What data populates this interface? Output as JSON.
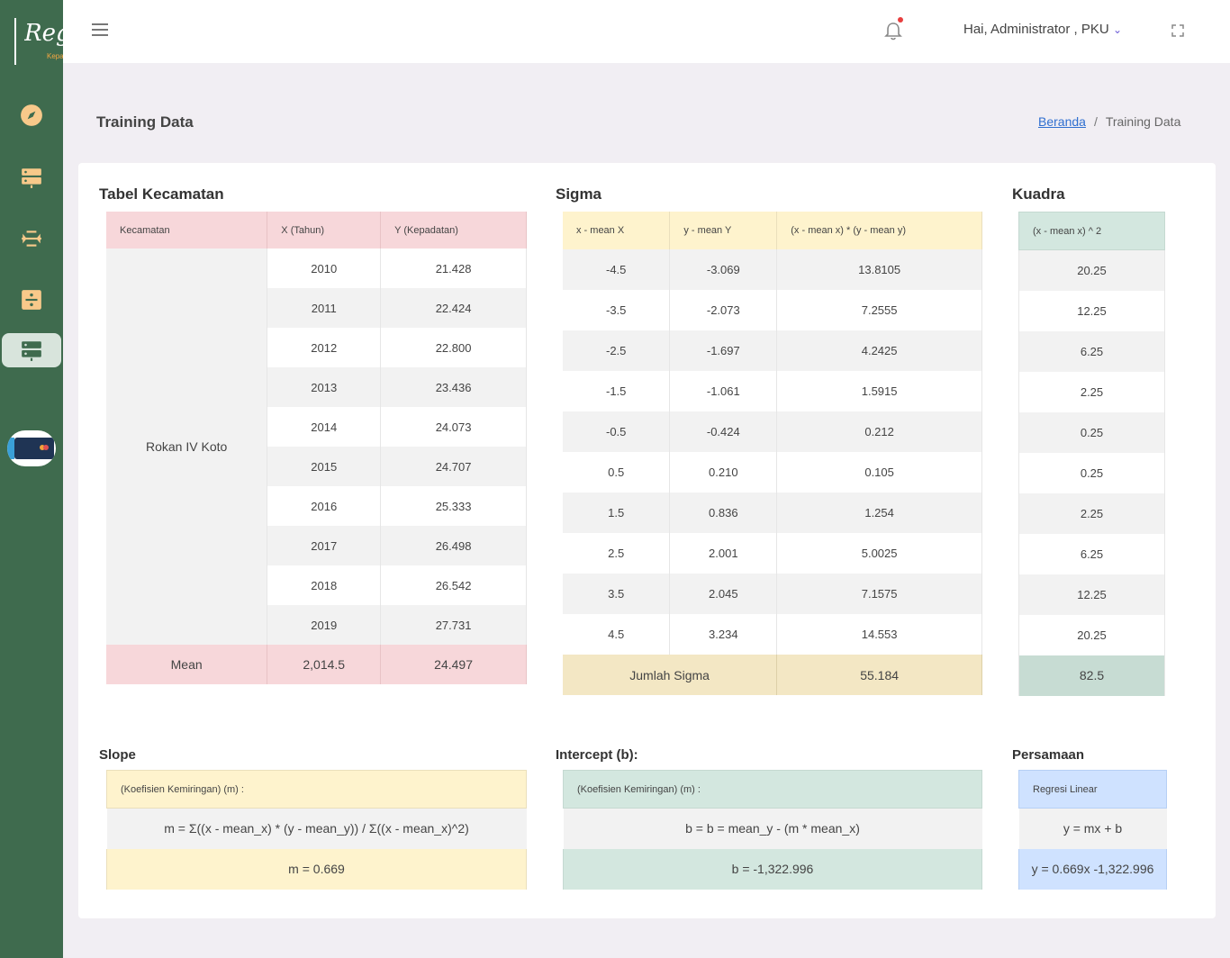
{
  "app": {
    "logo_text": "Regresi",
    "logo_subtitle": "Kepadatan Penduduk",
    "accent_color": "#3f6b4e",
    "sidebar_icons": [
      "compass-icon",
      "server-icon",
      "arrows-icon",
      "divide-icon",
      "server-icon",
      "card-icon"
    ]
  },
  "topbar": {
    "greeting": "Hai, Administrator , PKU",
    "chevron": "⌄"
  },
  "page": {
    "title": "Training Data",
    "breadcrumb_home": "Beranda",
    "breadcrumb_sep": "/",
    "breadcrumb_current": "Training Data"
  },
  "kecamatan": {
    "title": "Tabel Kecamatan",
    "headers": [
      "Kecamatan",
      "X (Tahun)",
      "Y (Kepadatan)"
    ],
    "name": "Rokan IV Koto",
    "rows": [
      {
        "x": "2010",
        "y": "21.428"
      },
      {
        "x": "2011",
        "y": "22.424"
      },
      {
        "x": "2012",
        "y": "22.800"
      },
      {
        "x": "2013",
        "y": "23.436"
      },
      {
        "x": "2014",
        "y": "24.073"
      },
      {
        "x": "2015",
        "y": "24.707"
      },
      {
        "x": "2016",
        "y": "25.333"
      },
      {
        "x": "2017",
        "y": "26.498"
      },
      {
        "x": "2018",
        "y": "26.542"
      },
      {
        "x": "2019",
        "y": "27.731"
      }
    ],
    "mean_label": "Mean",
    "mean_x": "2,014.5",
    "mean_y": "24.497"
  },
  "sigma": {
    "title": "Sigma",
    "headers": [
      "x - mean X",
      "y - mean Y",
      "(x - mean x) * (y - mean y)"
    ],
    "rows": [
      {
        "a": "-4.5",
        "b": "-3.069",
        "c": "13.8105"
      },
      {
        "a": "-3.5",
        "b": "-2.073",
        "c": "7.2555"
      },
      {
        "a": "-2.5",
        "b": "-1.697",
        "c": "4.2425"
      },
      {
        "a": "-1.5",
        "b": "-1.061",
        "c": "1.5915"
      },
      {
        "a": "-0.5",
        "b": "-0.424",
        "c": "0.212"
      },
      {
        "a": "0.5",
        "b": "0.210",
        "c": "0.105"
      },
      {
        "a": "1.5",
        "b": "0.836",
        "c": "1.254"
      },
      {
        "a": "2.5",
        "b": "2.001",
        "c": "5.0025"
      },
      {
        "a": "3.5",
        "b": "2.045",
        "c": "7.1575"
      },
      {
        "a": "4.5",
        "b": "3.234",
        "c": "14.553"
      }
    ],
    "sum_label": "Jumlah Sigma",
    "sum_value": "55.184"
  },
  "kuadra": {
    "title": "Kuadra",
    "header": "(x - mean x) ^ 2",
    "rows": [
      "20.25",
      "12.25",
      "6.25",
      "2.25",
      "0.25",
      "0.25",
      "2.25",
      "6.25",
      "12.25",
      "20.25"
    ],
    "sum_value": "82.5"
  },
  "slope": {
    "title": "Slope",
    "header": "(Koefisien Kemiringan) (m) :",
    "formula": "m = Σ((x - mean_x) * (y - mean_y)) / Σ((x - mean_x)^2)",
    "result": "m = 0.669"
  },
  "intercept": {
    "title": "Intercept (b):",
    "header": "(Koefisien Kemiringan) (m) :",
    "formula": "b = b = mean_y - (m * mean_x)",
    "result": "b = -1,322.996"
  },
  "persamaan": {
    "title": "Persamaan",
    "header": "Regresi Linear",
    "formula": "y = mx + b",
    "result": "y = 0.669x -1,322.996"
  }
}
